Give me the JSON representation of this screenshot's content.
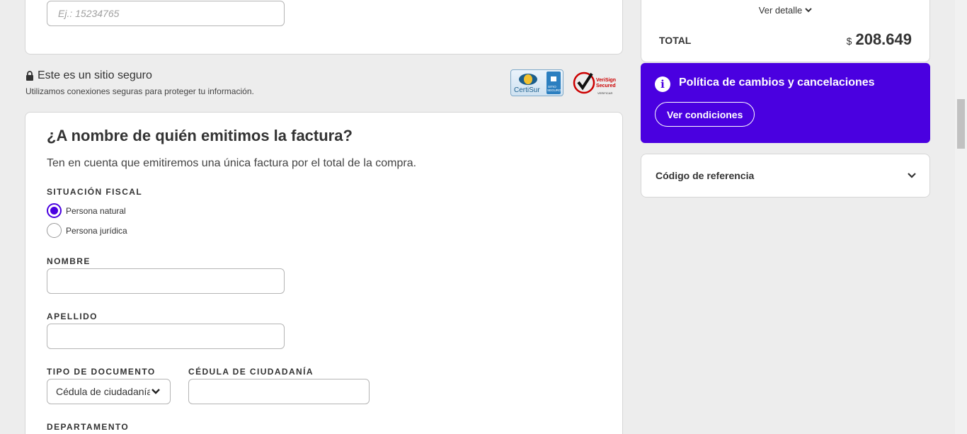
{
  "top_card": {
    "id_placeholder": "Ej.: 15234765"
  },
  "secure": {
    "title": "Este es un sitio seguro",
    "subtitle": "Utilizamos conexiones seguras para proteger tu información.",
    "certisur_text": "CertiSur",
    "certisur_badge": "SITIO SEGURO",
    "verisign_text_1": "VeriSign",
    "verisign_text_2": "Secured",
    "verisign_text_3": "VERIFICAR"
  },
  "invoice": {
    "title": "¿A nombre de quién emitimos la factura?",
    "intro": "Ten en cuenta que emitiremos una única factura por el total de la compra.",
    "fiscal_label": "SITUACIÓN FISCAL",
    "options": [
      {
        "label": "Persona natural",
        "selected": true
      },
      {
        "label": "Persona jurídica",
        "selected": false
      }
    ],
    "name_label": "NOMBRE",
    "name_value": "",
    "surname_label": "APELLIDO",
    "surname_value": "",
    "doc_type_label": "TIPO DE DOCUMENTO",
    "doc_type_value": "Cédula de ciudadanía",
    "doc_number_label": "CÉDULA DE CIUDADANÍA",
    "doc_number_value": "",
    "department_label": "DEPARTAMENTO"
  },
  "summary": {
    "detail_link": "Ver detalle",
    "total_label": "TOTAL",
    "currency": "$",
    "total_amount": "208.649"
  },
  "policy": {
    "title": "Política de cambios y cancelaciones",
    "button": "Ver condiciones",
    "bg_color": "#4a00e0"
  },
  "reference": {
    "label": "Código de referencia"
  },
  "colors": {
    "accent": "#4a00e0",
    "page_bg": "#ededed"
  }
}
